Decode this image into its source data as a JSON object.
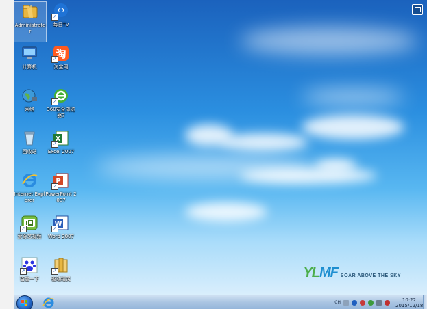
{
  "desktop": {
    "icons": [
      {
        "label": "Administrator"
      },
      {
        "label": "每日TV"
      },
      {
        "label": "计算机"
      },
      {
        "label": "淘宝网"
      },
      {
        "label": "网络"
      },
      {
        "label": "360安全浏览器7"
      },
      {
        "label": "回收站"
      },
      {
        "label": "Excel 2007"
      },
      {
        "label": "Internet Explorer"
      },
      {
        "label": "PowerPoint 2007"
      },
      {
        "label": "爱奇艺视频"
      },
      {
        "label": "Word 2007"
      },
      {
        "label": "百度一下"
      },
      {
        "label": "驱动精灵"
      }
    ],
    "brand": {
      "logo_a": "YL",
      "logo_b": "MF",
      "tagline": "SOAR ABOVE THE SKY"
    }
  },
  "taskbar": {
    "tray": {
      "lang": "CH",
      "time": "10:22",
      "date": "2015/12/18"
    }
  }
}
